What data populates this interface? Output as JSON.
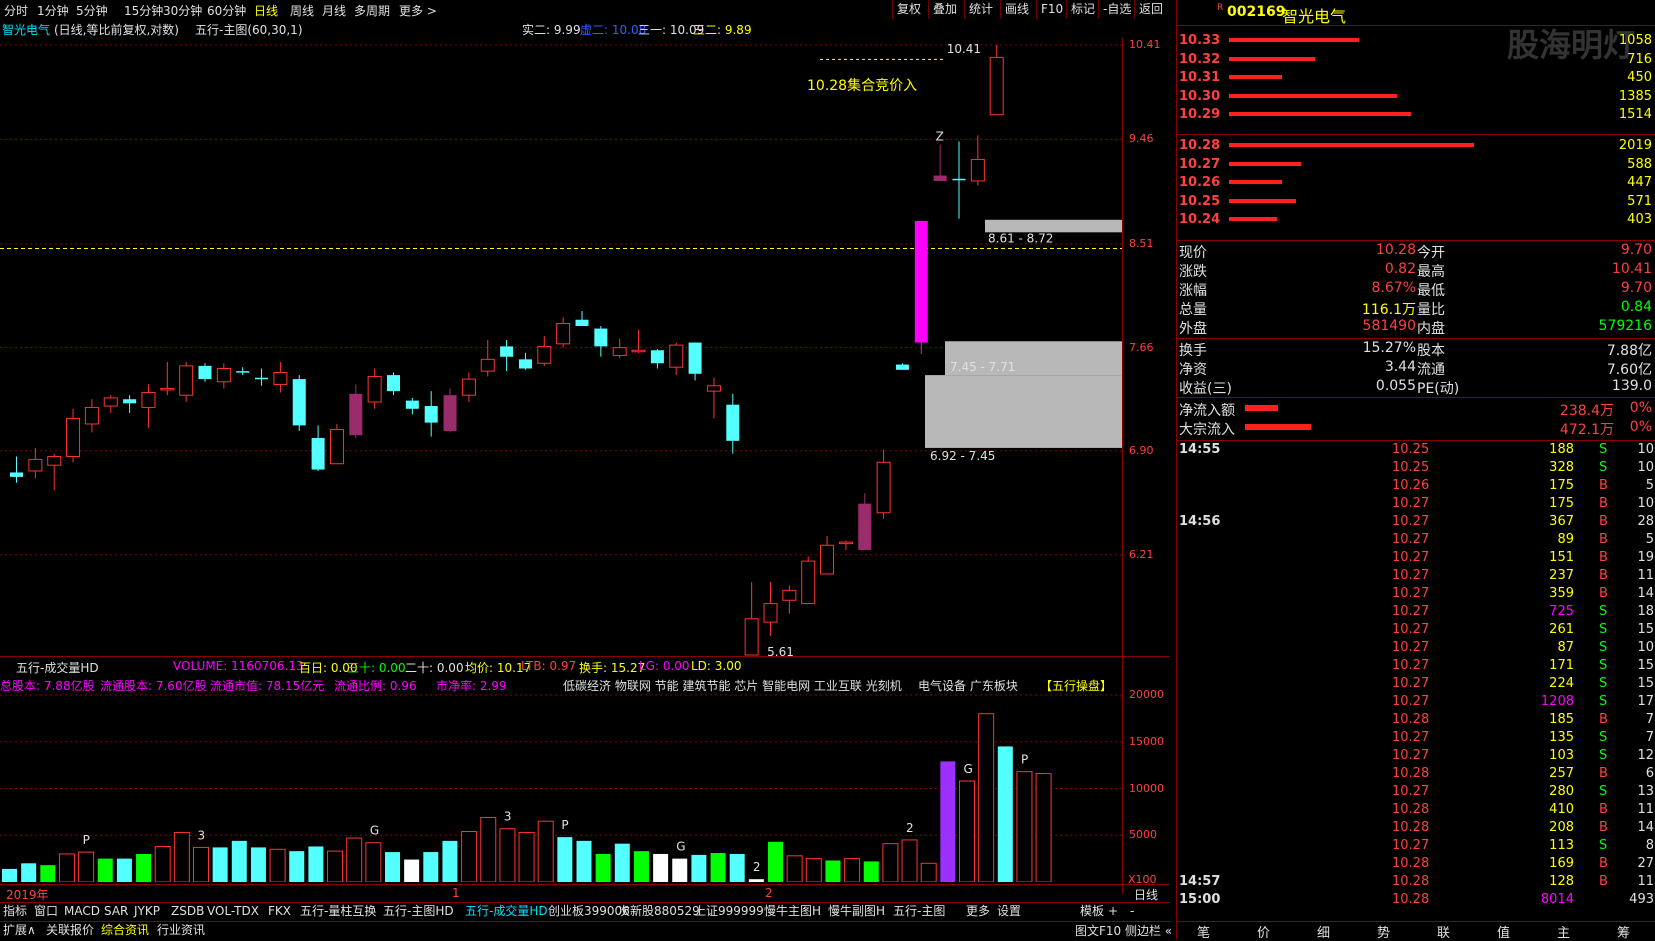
{
  "period_bar": {
    "items": [
      "分时",
      "1分钟",
      "5分钟",
      "15分钟",
      "30分钟",
      "60分钟",
      "日线",
      "周线",
      "月线",
      "多周期",
      "更多 >"
    ],
    "active": "日线"
  },
  "right_tools": [
    "复权",
    "叠加",
    "统计",
    "画线",
    "F10",
    "标记",
    "-自选",
    "返回"
  ],
  "chart_header": {
    "name": "智光电气",
    "mode": "(日线,等比前复权,对数)",
    "indicator": "五行-主图(60,30,1)",
    "vals": [
      {
        "label": "实二: 9.99",
        "color": "#e0e0e0"
      },
      {
        "label": "虚二: 10.08",
        "color": "#3060ff"
      },
      {
        "label": "三一: 10.09",
        "color": "#e0e0e0"
      },
      {
        "label": "三二: 9.89",
        "color": "#ffff00"
      }
    ]
  },
  "price_axis": [
    "10.41",
    "9.46",
    "8.51",
    "7.66",
    "6.90",
    "6.21"
  ],
  "annotations": {
    "auction": "10.28集合竞价入",
    "high_mark": "10.41",
    "low_mark": "5.61",
    "zone1": "8.61 - 8.72",
    "zone2": "7.45 - 7.71",
    "zone3": "6.92 - 7.45",
    "z_mark": "Z"
  },
  "vol_header": {
    "name": "五行-成交量HD",
    "items": [
      {
        "label": "VOLUME: 1160706.13",
        "color": "#ff00ff"
      },
      {
        "label": "百日: 0.00",
        "color": "#ffff00"
      },
      {
        "label": "三十: 0.00",
        "color": "#00ff00"
      },
      {
        "label": "二十: 0.00",
        "color": "#e0e0e0"
      },
      {
        "label": "均价: 10.17",
        "color": "#ffff00"
      },
      {
        "label": "LTB: 0.97",
        "color": "#ff4040"
      },
      {
        "label": "换手: 15.27",
        "color": "#ffff00"
      },
      {
        "label": "LG: 0.00",
        "color": "#ff00ff"
      },
      {
        "label": "LD: 3.00",
        "color": "#ffff00"
      }
    ],
    "info": [
      {
        "label": "总股本: 7.88亿股",
        "color": "#ff00ff"
      },
      {
        "label": "流通股本: 7.60亿股",
        "color": "#ff00ff"
      },
      {
        "label": "流通市值: 78.15亿元",
        "color": "#ff00ff"
      },
      {
        "label": "流通比例: 0.96",
        "color": "#ff00ff"
      },
      {
        "label": "市净率: 2.99",
        "color": "#ff00ff"
      }
    ],
    "concepts": "低碳经济 物联网 节能 建筑节能 芯片 智能电网 工业互联 光刻机",
    "sector": "电气设备  广东板块",
    "tag": "【五行操盘】"
  },
  "vol_axis": [
    "20000",
    "15000",
    "10000",
    "5000"
  ],
  "vol_scale": "X100",
  "vol_marks": [
    "P",
    "3",
    "G",
    "3",
    "P",
    "G",
    "2",
    "2",
    "G",
    "P"
  ],
  "time_axis": {
    "year": "2019年",
    "m1": "1",
    "m2": "2",
    "period": "日线"
  },
  "bottom_tabs": [
    "指标",
    "窗口",
    "MACD",
    "SAR",
    "JYKP",
    "ZSDB",
    "VOL-TDX",
    "FKX",
    "五行-量柱互换",
    "五行-主图HD",
    "五行-成交量HD",
    "创业板399006",
    "次新股880529",
    "上证999999",
    "慢牛主图H",
    "慢牛副图H",
    "五行-主图",
    "更多",
    "设置",
    "模板",
    "+",
    "-"
  ],
  "bottom_tabs_active": "五行-成交量HD",
  "bottom_tabs2": [
    "扩展∧",
    "关联报价",
    "综合资讯",
    "行业资讯"
  ],
  "status_right": "图文F10 侧边栏 «",
  "stock": {
    "code": "002169",
    "name": "智光电气",
    "flag": "R",
    "watermark": "股海明灯"
  },
  "asks": [
    {
      "price": "10.33",
      "vol": "1058",
      "bar": 0.27
    },
    {
      "price": "10.32",
      "vol": "716",
      "bar": 0.18
    },
    {
      "price": "10.31",
      "vol": "450",
      "bar": 0.11
    },
    {
      "price": "10.30",
      "vol": "1385",
      "bar": 0.35
    },
    {
      "price": "10.29",
      "vol": "1514",
      "bar": 0.38
    }
  ],
  "bids": [
    {
      "price": "10.28",
      "vol": "2019",
      "bar": 0.51
    },
    {
      "price": "10.27",
      "vol": "588",
      "bar": 0.15
    },
    {
      "price": "10.26",
      "vol": "447",
      "bar": 0.11
    },
    {
      "price": "10.25",
      "vol": "571",
      "bar": 0.14
    },
    {
      "price": "10.24",
      "vol": "403",
      "bar": 0.1
    }
  ],
  "stats": [
    {
      "l1": "现价",
      "v1": "10.28",
      "c1": "#ff4040",
      "l2": "今开",
      "v2": "9.70",
      "c2": "#ff4040"
    },
    {
      "l1": "涨跌",
      "v1": "0.82",
      "c1": "#ff4040",
      "l2": "最高",
      "v2": "10.41",
      "c2": "#ff4040"
    },
    {
      "l1": "涨幅",
      "v1": "8.67%",
      "c1": "#ff4040",
      "l2": "最低",
      "v2": "9.70",
      "c2": "#ff4040"
    },
    {
      "l1": "总量",
      "v1": "116.1万",
      "c1": "#ffff00",
      "l2": "量比",
      "v2": "0.84",
      "c2": "#00ff00"
    },
    {
      "l1": "外盘",
      "v1": "581490",
      "c1": "#ff4040",
      "l2": "内盘",
      "v2": "579216",
      "c2": "#00ff00"
    }
  ],
  "stats2": [
    {
      "l1": "换手",
      "v1": "15.27%",
      "c1": "#e0e0e0",
      "l2": "股本",
      "v2": "7.88亿",
      "c2": "#e0e0e0"
    },
    {
      "l1": "净资",
      "v1": "3.44",
      "c1": "#e0e0e0",
      "l2": "流通",
      "v2": "7.60亿",
      "c2": "#e0e0e0"
    },
    {
      "l1": "收益(三)",
      "v1": "0.055",
      "c1": "#e0e0e0",
      "l2": "PE(动)",
      "v2": "139.0",
      "c2": "#e0e0e0"
    }
  ],
  "flows": [
    {
      "label": "净流入额",
      "val": "238.4万",
      "pct": "0%",
      "bar": 0.3
    },
    {
      "label": "大宗流入",
      "val": "472.1万",
      "pct": "0%",
      "bar": 0.6
    }
  ],
  "ticks": [
    {
      "t": "14:55",
      "p": "10.25",
      "v": "188",
      "d": "S",
      "n": "10"
    },
    {
      "t": "",
      "p": "10.25",
      "v": "328",
      "d": "S",
      "n": "10"
    },
    {
      "t": "",
      "p": "10.26",
      "v": "175",
      "d": "B",
      "n": "5"
    },
    {
      "t": "",
      "p": "10.27",
      "v": "175",
      "d": "B",
      "n": "10"
    },
    {
      "t": "14:56",
      "p": "10.27",
      "v": "367",
      "d": "B",
      "n": "28"
    },
    {
      "t": "",
      "p": "10.27",
      "v": "89",
      "d": "B",
      "n": "5"
    },
    {
      "t": "",
      "p": "10.27",
      "v": "151",
      "d": "B",
      "n": "19"
    },
    {
      "t": "",
      "p": "10.27",
      "v": "237",
      "d": "B",
      "n": "11"
    },
    {
      "t": "",
      "p": "10.27",
      "v": "359",
      "d": "B",
      "n": "14"
    },
    {
      "t": "",
      "p": "10.27",
      "v": "725",
      "d": "S",
      "n": "18"
    },
    {
      "t": "",
      "p": "10.27",
      "v": "261",
      "d": "S",
      "n": "15"
    },
    {
      "t": "",
      "p": "10.27",
      "v": "87",
      "d": "S",
      "n": "10"
    },
    {
      "t": "",
      "p": "10.27",
      "v": "171",
      "d": "S",
      "n": "15"
    },
    {
      "t": "",
      "p": "10.27",
      "v": "224",
      "d": "S",
      "n": "15"
    },
    {
      "t": "",
      "p": "10.27",
      "v": "1208",
      "d": "S",
      "n": "17"
    },
    {
      "t": "",
      "p": "10.28",
      "v": "185",
      "d": "B",
      "n": "7"
    },
    {
      "t": "",
      "p": "10.27",
      "v": "135",
      "d": "S",
      "n": "7"
    },
    {
      "t": "",
      "p": "10.27",
      "v": "103",
      "d": "S",
      "n": "12"
    },
    {
      "t": "",
      "p": "10.28",
      "v": "257",
      "d": "B",
      "n": "6"
    },
    {
      "t": "",
      "p": "10.27",
      "v": "280",
      "d": "S",
      "n": "13"
    },
    {
      "t": "",
      "p": "10.28",
      "v": "410",
      "d": "B",
      "n": "11"
    },
    {
      "t": "",
      "p": "10.28",
      "v": "208",
      "d": "B",
      "n": "14"
    },
    {
      "t": "",
      "p": "10.27",
      "v": "113",
      "d": "S",
      "n": "8"
    },
    {
      "t": "",
      "p": "10.28",
      "v": "169",
      "d": "B",
      "n": "27"
    },
    {
      "t": "14:57",
      "p": "10.28",
      "v": "128",
      "d": "B",
      "n": "11"
    },
    {
      "t": "15:00",
      "p": "10.28",
      "v": "8014",
      "d": "",
      "n": "493"
    }
  ],
  "bottom_right_tabs": [
    "笔",
    "价",
    "细",
    "势",
    "联",
    "值",
    "主",
    "筹"
  ],
  "candles": [
    {
      "o": 6.75,
      "h": 6.86,
      "l": 6.68,
      "c": 6.72,
      "col": "c"
    },
    {
      "o": 6.76,
      "h": 6.92,
      "l": 6.71,
      "c": 6.84,
      "col": "r"
    },
    {
      "o": 6.8,
      "h": 6.88,
      "l": 6.63,
      "c": 6.86,
      "col": "r"
    },
    {
      "o": 6.86,
      "h": 7.2,
      "l": 6.82,
      "c": 7.13,
      "col": "r"
    },
    {
      "o": 7.09,
      "h": 7.27,
      "l": 7.03,
      "c": 7.21,
      "col": "r"
    },
    {
      "o": 7.22,
      "h": 7.3,
      "l": 7.17,
      "c": 7.28,
      "col": "r"
    },
    {
      "o": 7.27,
      "h": 7.3,
      "l": 7.17,
      "c": 7.24,
      "col": "c"
    },
    {
      "o": 7.21,
      "h": 7.38,
      "l": 7.06,
      "c": 7.32,
      "col": "r"
    },
    {
      "o": 7.34,
      "h": 7.55,
      "l": 7.3,
      "c": 7.35,
      "col": "r"
    },
    {
      "o": 7.3,
      "h": 7.55,
      "l": 7.25,
      "c": 7.52,
      "col": "r"
    },
    {
      "o": 7.52,
      "h": 7.54,
      "l": 7.4,
      "c": 7.42,
      "col": "c"
    },
    {
      "o": 7.4,
      "h": 7.54,
      "l": 7.35,
      "c": 7.5,
      "col": "r"
    },
    {
      "o": 7.48,
      "h": 7.51,
      "l": 7.45,
      "c": 7.47,
      "col": "c"
    },
    {
      "o": 7.43,
      "h": 7.5,
      "l": 7.37,
      "c": 7.42,
      "col": "c"
    },
    {
      "o": 7.38,
      "h": 7.55,
      "l": 7.32,
      "c": 7.47,
      "col": "r"
    },
    {
      "o": 7.42,
      "h": 7.45,
      "l": 7.04,
      "c": 7.08,
      "col": "c"
    },
    {
      "o": 6.99,
      "h": 7.08,
      "l": 6.76,
      "c": 6.77,
      "col": "c"
    },
    {
      "o": 6.81,
      "h": 7.09,
      "l": 6.81,
      "c": 7.05,
      "col": "r"
    },
    {
      "o": 7.01,
      "h": 7.38,
      "l": 6.99,
      "c": 7.31,
      "col": "p"
    },
    {
      "o": 7.25,
      "h": 7.5,
      "l": 7.2,
      "c": 7.44,
      "col": "r"
    },
    {
      "o": 7.45,
      "h": 7.47,
      "l": 7.3,
      "c": 7.33,
      "col": "c"
    },
    {
      "o": 7.26,
      "h": 7.28,
      "l": 7.16,
      "c": 7.2,
      "col": "c"
    },
    {
      "o": 7.1,
      "h": 7.33,
      "l": 7.0,
      "c": 7.22,
      "col": "c"
    },
    {
      "o": 7.04,
      "h": 7.35,
      "l": 7.03,
      "c": 7.3,
      "col": "p"
    },
    {
      "o": 7.3,
      "h": 7.47,
      "l": 7.25,
      "c": 7.42,
      "col": "r"
    },
    {
      "o": 7.48,
      "h": 7.72,
      "l": 7.44,
      "c": 7.57,
      "col": "r"
    },
    {
      "o": 7.67,
      "h": 7.72,
      "l": 7.48,
      "c": 7.59,
      "col": "c"
    },
    {
      "o": 7.57,
      "h": 7.62,
      "l": 7.49,
      "c": 7.5,
      "col": "c"
    },
    {
      "o": 7.54,
      "h": 7.75,
      "l": 7.52,
      "c": 7.67,
      "col": "r"
    },
    {
      "o": 7.69,
      "h": 7.9,
      "l": 7.66,
      "c": 7.85,
      "col": "r"
    },
    {
      "o": 7.88,
      "h": 7.95,
      "l": 7.83,
      "c": 7.83,
      "col": "c"
    },
    {
      "o": 7.81,
      "h": 7.83,
      "l": 7.59,
      "c": 7.67,
      "col": "c"
    },
    {
      "o": 7.6,
      "h": 7.73,
      "l": 7.58,
      "c": 7.66,
      "col": "r"
    },
    {
      "o": 7.64,
      "h": 7.8,
      "l": 7.62,
      "c": 7.64,
      "col": "r"
    },
    {
      "o": 7.64,
      "h": 7.65,
      "l": 7.5,
      "c": 7.54,
      "col": "c"
    },
    {
      "o": 7.51,
      "h": 7.7,
      "l": 7.45,
      "c": 7.68,
      "col": "r"
    },
    {
      "o": 7.7,
      "h": 7.7,
      "l": 7.41,
      "c": 7.46,
      "col": "c"
    },
    {
      "o": 7.33,
      "h": 7.43,
      "l": 7.13,
      "c": 7.37,
      "col": "r"
    },
    {
      "o": 7.23,
      "h": 7.31,
      "l": 6.88,
      "c": 6.97,
      "col": "c"
    },
    {
      "o": 5.82,
      "h": 6.04,
      "l": 5.61,
      "c": 5.61,
      "col": "r"
    },
    {
      "o": 5.8,
      "h": 6.04,
      "l": 5.72,
      "c": 5.91,
      "col": "r"
    },
    {
      "o": 5.93,
      "h": 6.02,
      "l": 5.85,
      "c": 5.99,
      "col": "r"
    },
    {
      "o": 5.91,
      "h": 6.2,
      "l": 5.91,
      "c": 6.17,
      "col": "r"
    },
    {
      "o": 6.09,
      "h": 6.33,
      "l": 6.09,
      "c": 6.27,
      "col": "r"
    },
    {
      "o": 6.29,
      "h": 6.3,
      "l": 6.24,
      "c": 6.29,
      "col": "r"
    },
    {
      "o": 6.24,
      "h": 6.61,
      "l": 6.24,
      "c": 6.54,
      "col": "p"
    },
    {
      "o": 6.48,
      "h": 6.91,
      "l": 6.44,
      "c": 6.82,
      "col": "r"
    },
    {
      "o": 7.49,
      "h": 7.54,
      "l": 7.49,
      "c": 7.53,
      "col": "c"
    },
    {
      "o": 7.7,
      "h": 8.71,
      "l": 7.61,
      "c": 8.71,
      "col": "m"
    },
    {
      "o": 9.07,
      "h": 9.41,
      "l": 9.07,
      "c": 9.12,
      "col": "p"
    },
    {
      "o": 9.09,
      "h": 9.44,
      "l": 8.73,
      "c": 9.09,
      "col": "c"
    },
    {
      "o": 9.27,
      "h": 9.5,
      "l": 9.03,
      "c": 9.07,
      "col": "r"
    },
    {
      "o": 9.7,
      "h": 10.41,
      "l": 9.7,
      "c": 10.28,
      "col": "r"
    }
  ],
  "volumes": [
    {
      "v": 1400,
      "col": "c"
    },
    {
      "v": 2000,
      "col": "c"
    },
    {
      "v": 1800,
      "col": "g"
    },
    {
      "v": 3000,
      "col": "r"
    },
    {
      "v": 3200,
      "col": "r"
    },
    {
      "v": 2500,
      "col": "g"
    },
    {
      "v": 2500,
      "col": "c"
    },
    {
      "v": 3000,
      "col": "g"
    },
    {
      "v": 3800,
      "col": "r"
    },
    {
      "v": 5300,
      "col": "r"
    },
    {
      "v": 3700,
      "col": "r"
    },
    {
      "v": 3700,
      "col": "c"
    },
    {
      "v": 4400,
      "col": "c"
    },
    {
      "v": 3700,
      "col": "c"
    },
    {
      "v": 3500,
      "col": "r"
    },
    {
      "v": 3300,
      "col": "c"
    },
    {
      "v": 3800,
      "col": "c"
    },
    {
      "v": 3300,
      "col": "r"
    },
    {
      "v": 4700,
      "col": "r"
    },
    {
      "v": 4200,
      "col": "r"
    },
    {
      "v": 3200,
      "col": "c"
    },
    {
      "v": 2400,
      "col": "w"
    },
    {
      "v": 3200,
      "col": "c"
    },
    {
      "v": 4400,
      "col": "c"
    },
    {
      "v": 5400,
      "col": "r"
    },
    {
      "v": 6900,
      "col": "r"
    },
    {
      "v": 5700,
      "col": "r"
    },
    {
      "v": 5300,
      "col": "r"
    },
    {
      "v": 6500,
      "col": "r"
    },
    {
      "v": 4800,
      "col": "c"
    },
    {
      "v": 4400,
      "col": "c"
    },
    {
      "v": 3000,
      "col": "g"
    },
    {
      "v": 4100,
      "col": "c"
    },
    {
      "v": 3300,
      "col": "g"
    },
    {
      "v": 3000,
      "col": "w"
    },
    {
      "v": 2500,
      "col": "w"
    },
    {
      "v": 2900,
      "col": "c"
    },
    {
      "v": 3100,
      "col": "g"
    },
    {
      "v": 3000,
      "col": "c"
    },
    {
      "v": 300,
      "col": "w"
    },
    {
      "v": 4300,
      "col": "g"
    },
    {
      "v": 2800,
      "col": "r"
    },
    {
      "v": 2500,
      "col": "r"
    },
    {
      "v": 2300,
      "col": "g"
    },
    {
      "v": 2500,
      "col": "r"
    },
    {
      "v": 2200,
      "col": "g"
    },
    {
      "v": 4100,
      "col": "r"
    },
    {
      "v": 4500,
      "col": "r"
    },
    {
      "v": 2000,
      "col": "r"
    },
    {
      "v": 12900,
      "col": "m"
    },
    {
      "v": 10800,
      "col": "r"
    },
    {
      "v": 18000,
      "col": "r"
    },
    {
      "v": 14500,
      "col": "c"
    },
    {
      "v": 11800,
      "col": "r"
    },
    {
      "v": 11600,
      "col": "r"
    }
  ]
}
